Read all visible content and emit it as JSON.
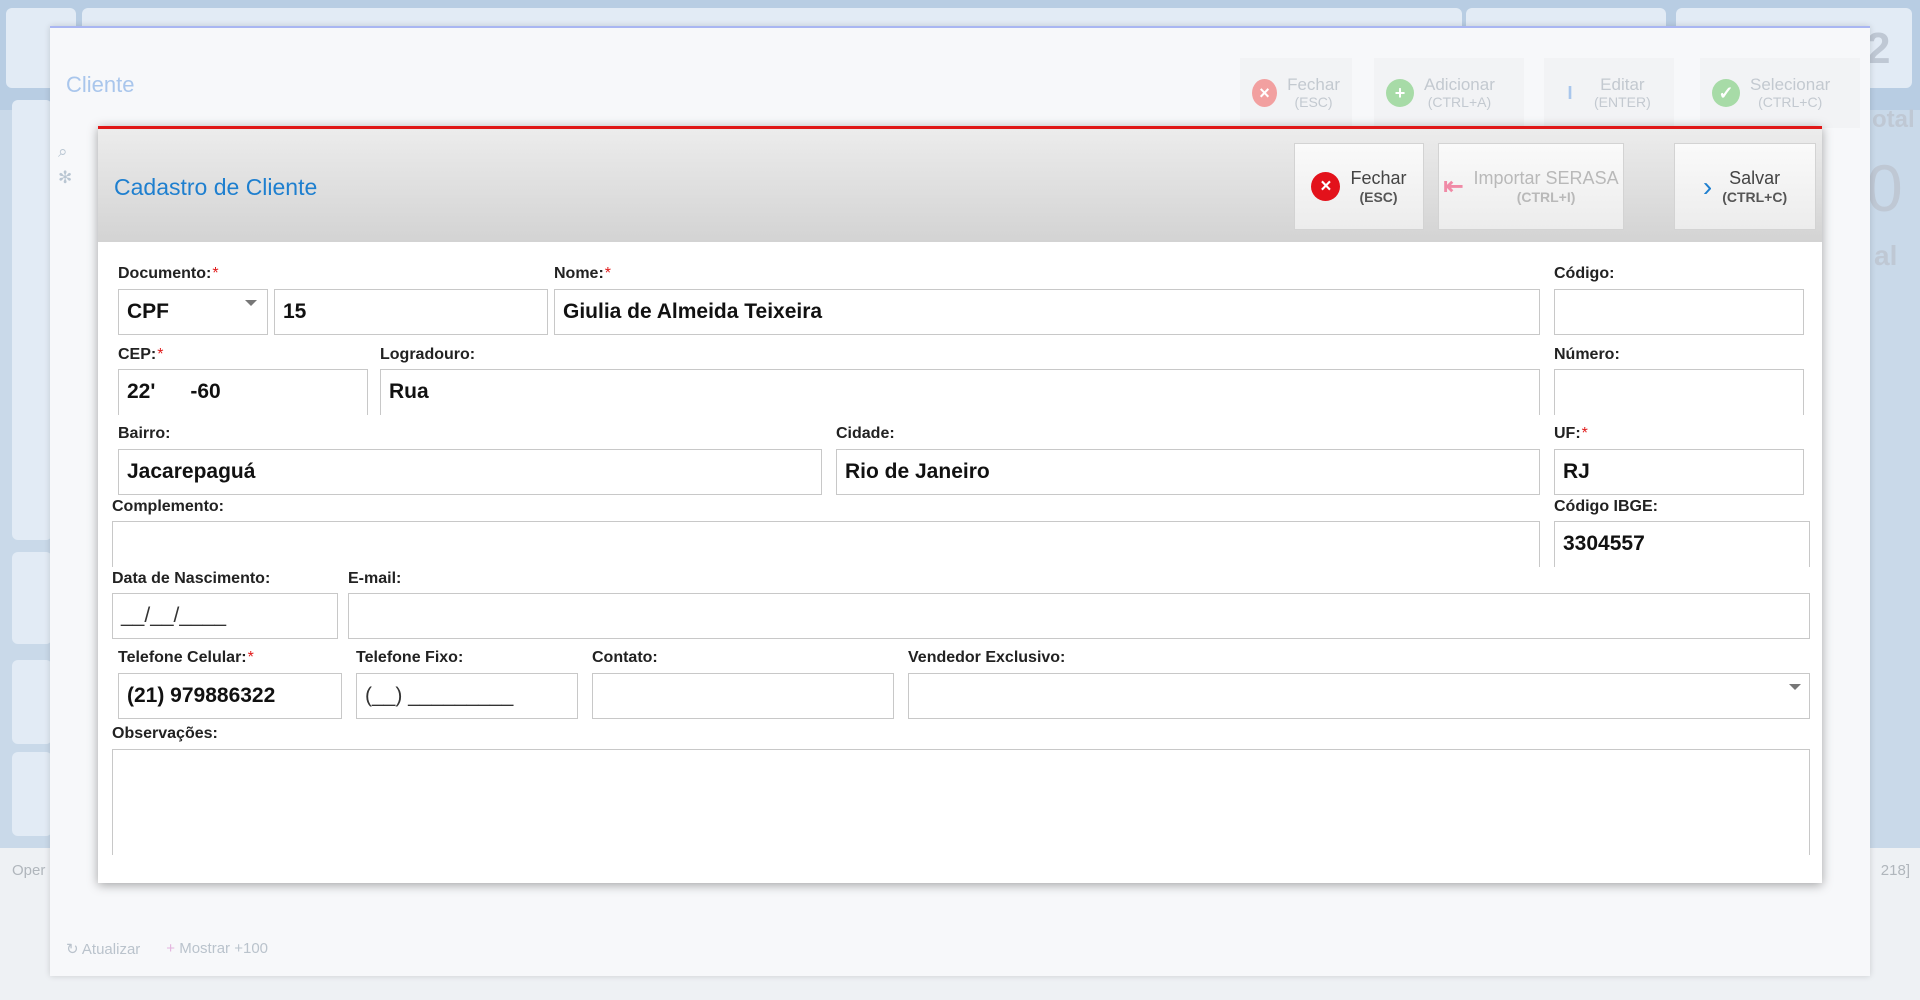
{
  "background": {
    "right_big_number": "2",
    "right_label_fragment": "otal",
    "right_big_zero": "0",
    "right_small_fragment": "al",
    "oper_text": "Oper",
    "count_text": "218]"
  },
  "outer_window": {
    "title": "Cliente",
    "buttons": [
      {
        "label": "Fechar",
        "shortcut": "(ESC)",
        "icon": "close-icon",
        "color": "#f2a0a0"
      },
      {
        "label": "Adicionar",
        "shortcut": "(CTRL+A)",
        "icon": "plus-icon",
        "color": "#a7dba7"
      },
      {
        "label": "Editar",
        "shortcut": "(ENTER)",
        "icon": "text-cursor-icon",
        "color": "#a9c6ec"
      },
      {
        "label": "Selecionar",
        "shortcut": "(CTRL+C)",
        "icon": "check-icon",
        "color": "#a7dba7"
      }
    ],
    "footer": {
      "refresh_label": "Atualizar",
      "more_label": "Mostrar +100"
    }
  },
  "modal": {
    "title": "Cadastro de Cliente",
    "buttons": {
      "close": {
        "label": "Fechar",
        "shortcut": "(ESC)"
      },
      "import": {
        "label": "Importar SERASA",
        "shortcut": "(CTRL+I)"
      },
      "save": {
        "label": "Salvar",
        "shortcut": "(CTRL+C)"
      }
    },
    "form": {
      "documento": {
        "label": "Documento:",
        "type_value": "CPF",
        "value": "15"
      },
      "nome": {
        "label": "Nome:",
        "value": "Giulia de Almeida Teixeira"
      },
      "codigo": {
        "label": "Código:",
        "value": ""
      },
      "cep": {
        "label": "CEP:",
        "value": "22'      -60"
      },
      "logradouro": {
        "label": "Logradouro:",
        "value": "Rua"
      },
      "numero": {
        "label": "Número:",
        "value": ""
      },
      "bairro": {
        "label": "Bairro:",
        "value": "Jacarepaguá"
      },
      "cidade": {
        "label": "Cidade:",
        "value": "Rio de Janeiro"
      },
      "uf": {
        "label": "UF:",
        "value": "RJ"
      },
      "complemento": {
        "label": "Complemento:",
        "value": ""
      },
      "codigo_ibge": {
        "label": "Código IBGE:",
        "value": "3304557"
      },
      "data_nascimento": {
        "label": "Data de Nascimento:",
        "value": "__/__/____"
      },
      "email": {
        "label": "E-mail:",
        "value": ""
      },
      "telefone_celular": {
        "label": "Telefone Celular:",
        "value": "(21) 979886322"
      },
      "telefone_fixo": {
        "label": "Telefone Fixo:",
        "value": "(__) _________"
      },
      "contato": {
        "label": "Contato:",
        "value": ""
      },
      "vendedor": {
        "label": "Vendedor Exclusivo:",
        "value": ""
      },
      "observacoes": {
        "label": "Observações:",
        "value": ""
      }
    }
  }
}
